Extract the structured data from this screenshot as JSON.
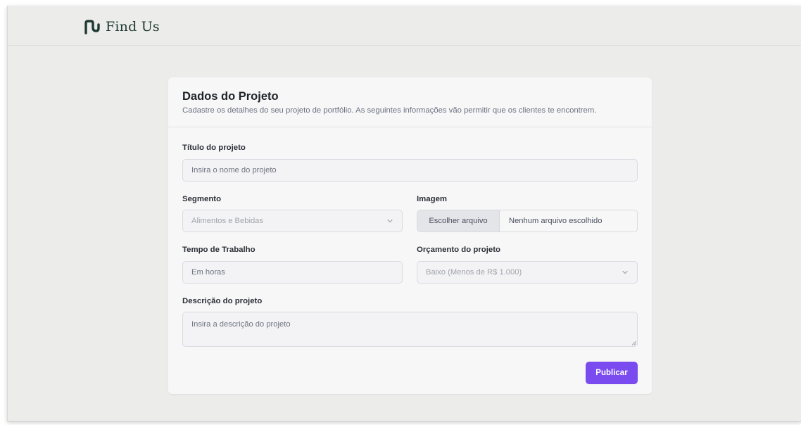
{
  "brand": {
    "name": "Find Us",
    "icon": "findus-logo-icon",
    "color": "#1f3a33"
  },
  "form": {
    "title": "Dados do Projeto",
    "subtitle": "Cadastre os detalhes do seu projeto de portfólio. As seguintes informações vão permitir que os clientes te encontrem.",
    "project_title": {
      "label": "Título do projeto",
      "placeholder": "Insira o nome do projeto"
    },
    "segment": {
      "label": "Segmento",
      "value": "Alimentos e Bebidas",
      "icon": "chevron-down-icon"
    },
    "image": {
      "label": "Imagem",
      "button_label": "Escolher arquivo",
      "status": "Nenhum arquivo escolhido"
    },
    "work_time": {
      "label": "Tempo de Trabalho",
      "placeholder": "Em horas"
    },
    "budget": {
      "label": "Orçamento do projeto",
      "value": "Baixo (Menos de R$ 1.000)",
      "icon": "chevron-down-icon"
    },
    "description": {
      "label": "Descrição do projeto",
      "placeholder": "Insira a descrição do projeto"
    },
    "submit_label": "Publicar"
  },
  "colors": {
    "accent": "#7a4cf0",
    "background": "#ececeb",
    "card": "#f7f7f8"
  }
}
